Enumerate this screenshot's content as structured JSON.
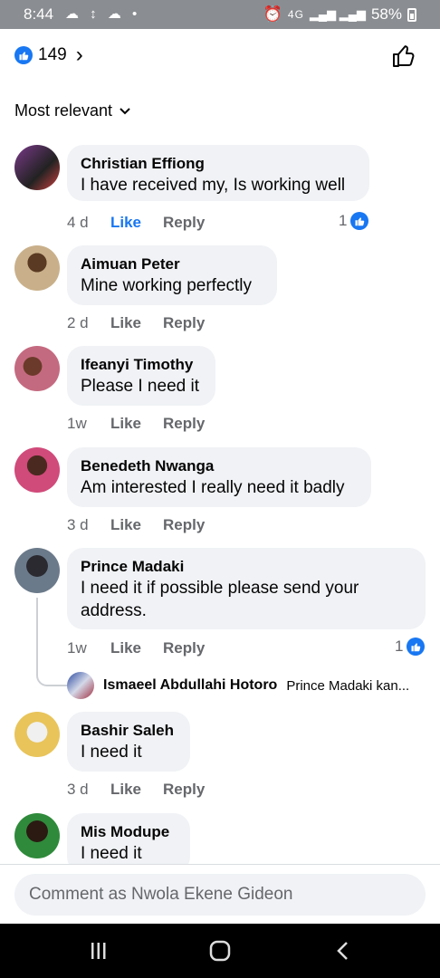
{
  "status_bar": {
    "time": "8:44",
    "notification_icons": "☁ ↕ ☁ •",
    "network_label": "4G",
    "battery": "58%"
  },
  "header": {
    "reaction_count": "149"
  },
  "sort": {
    "label": "Most relevant"
  },
  "comments": [
    {
      "name": "Christian Effiong",
      "text": "I have received my, Is working well",
      "time": "4 d",
      "like": "Like",
      "reply": "Reply",
      "reactions": "1",
      "liked": true,
      "avatar_color": "#6d3b7a"
    },
    {
      "name": "Aimuan Peter",
      "text": "Mine working perfectly",
      "time": "2 d",
      "like": "Like",
      "reply": "Reply",
      "avatar_color": "#8b6a3e"
    },
    {
      "name": "Ifeanyi Timothy",
      "text": "Please I need it",
      "time": "1w",
      "like": "Like",
      "reply": "Reply",
      "avatar_color": "#b44a5a"
    },
    {
      "name": "Benedeth Nwanga",
      "text": "Am interested I really need it badly",
      "time": "3 d",
      "like": "Like",
      "reply": "Reply",
      "avatar_color": "#c03a6a"
    },
    {
      "name": "Prince Madaki",
      "text": "I need it if possible please send your\naddress.",
      "time": "1w",
      "like": "Like",
      "reply": "Reply",
      "reactions": "1",
      "avatar_color": "#3b4a5e"
    },
    {
      "name": "Bashir Saleh",
      "text": "I need it",
      "time": "3 d",
      "like": "Like",
      "reply": "Reply",
      "avatar_color": "#e8b23a"
    },
    {
      "name": "Mis Modupe",
      "text": "I need it",
      "avatar_color": "#2f7a3b"
    }
  ],
  "sub_reply": {
    "name": "Ismaeel Abdullahi Hotoro",
    "text": "Prince Madaki kan..."
  },
  "composer": {
    "placeholder": "Comment as Nwola Ekene Gideon"
  },
  "colors": {
    "accent": "#1877f2",
    "bubble": "#f0f2f5",
    "muted": "#65676b"
  }
}
